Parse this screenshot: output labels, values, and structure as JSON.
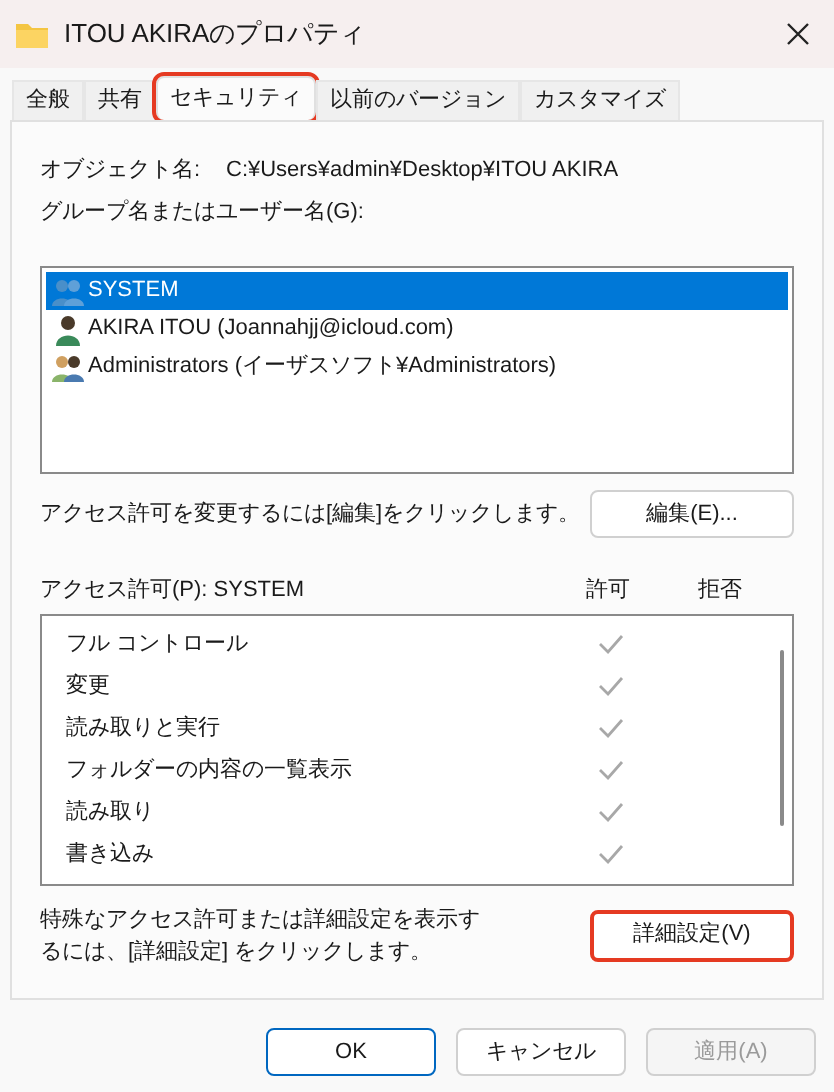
{
  "window": {
    "title": "ITOU AKIRAのプロパティ"
  },
  "tabs": [
    {
      "label": "全般",
      "selected": false,
      "highlighted": false
    },
    {
      "label": "共有",
      "selected": false,
      "highlighted": false
    },
    {
      "label": "セキュリティ",
      "selected": true,
      "highlighted": true
    },
    {
      "label": "以前のバージョン",
      "selected": false,
      "highlighted": false
    },
    {
      "label": "カスタマイズ",
      "selected": false,
      "highlighted": false
    }
  ],
  "object_name": {
    "label": "オブジェクト名:",
    "value": "C:¥Users¥admin¥Desktop¥ITOU AKIRA"
  },
  "users_label": "グループ名またはユーザー名(G):",
  "users": [
    {
      "name": "SYSTEM",
      "kind": "group",
      "selected": true
    },
    {
      "name": "AKIRA ITOU (Joannahjj@icloud.com)",
      "kind": "user",
      "selected": false
    },
    {
      "name": "Administrators (イーザスソフト¥Administrators)",
      "kind": "admins",
      "selected": false
    }
  ],
  "edit_hint": "アクセス許可を変更するには[編集]をクリックします。",
  "edit_button": {
    "label": "編集(E)...",
    "highlighted": false
  },
  "permissions": {
    "label": "アクセス許可(P): SYSTEM",
    "allow_header": "許可",
    "deny_header": "拒否",
    "rows": [
      {
        "name": "フル コントロール",
        "allow": true,
        "deny": false
      },
      {
        "name": "変更",
        "allow": true,
        "deny": false
      },
      {
        "name": "読み取りと実行",
        "allow": true,
        "deny": false
      },
      {
        "name": "フォルダーの内容の一覧表示",
        "allow": true,
        "deny": false
      },
      {
        "name": "読み取り",
        "allow": true,
        "deny": false
      },
      {
        "name": "書き込み",
        "allow": true,
        "deny": false
      }
    ]
  },
  "advanced_hint": "特殊なアクセス許可または詳細設定を表示するには、[詳細設定] をクリックします。",
  "advanced_button": {
    "label": "詳細設定(V)",
    "highlighted": true
  },
  "buttons": [
    {
      "label": "OK",
      "default": true,
      "disabled": false
    },
    {
      "label": "キャンセル",
      "default": false,
      "disabled": false
    },
    {
      "label": "適用(A)",
      "default": false,
      "disabled": true
    }
  ]
}
